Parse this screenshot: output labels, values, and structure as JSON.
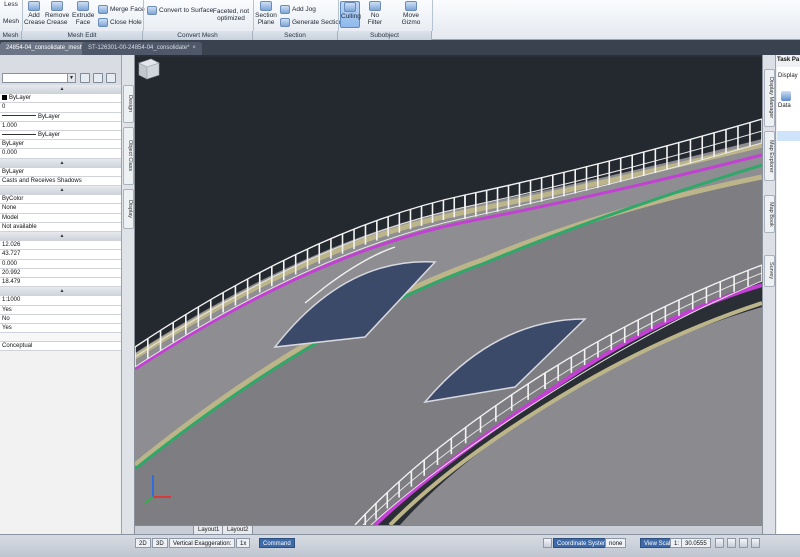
{
  "ribbon": {
    "buttons": {
      "less": "Less",
      "mesh": "Mesh",
      "add_crease": "Add Crease",
      "remove_crease": "Remove Crease",
      "extrude_face": "Extrude Face",
      "merge_face": "Merge Face",
      "close_hole": "Close Hole",
      "convert_to_surface": "Convert to Surface",
      "faceted": "Faceted, not optimized",
      "section_plane": "Section Plane",
      "add_jog": "Add Jog",
      "generate_section": "Generate Section",
      "culling": "Culling",
      "no_filter": "No Filter",
      "move_gizmo": "Move Gizmo"
    },
    "panels": {
      "mesh": "Mesh",
      "mesh_edit": "Mesh Edit",
      "convert_mesh": "Convert Mesh",
      "section": "Section",
      "subobject": "Subobject"
    }
  },
  "tabs": [
    {
      "label": "24854-04_consolidate_mesh*",
      "active": true
    },
    {
      "label": "ST-126301-00-24854-04_consolidate*",
      "active": false
    }
  ],
  "properties": {
    "rows": [
      {
        "type": "cat",
        "text": "▲"
      },
      {
        "type": "swatch",
        "text": "ByLayer"
      },
      {
        "type": "val",
        "text": "0"
      },
      {
        "type": "line",
        "text": "ByLayer"
      },
      {
        "type": "val",
        "text": "1.000"
      },
      {
        "type": "line",
        "text": "ByLayer"
      },
      {
        "type": "val",
        "text": "ByLayer"
      },
      {
        "type": "val",
        "text": "0.000"
      },
      {
        "type": "cat",
        "text": "▲"
      },
      {
        "type": "val",
        "text": "ByLayer"
      },
      {
        "type": "val",
        "text": "Casts and Receives Shadows"
      },
      {
        "type": "cat",
        "text": "▲"
      },
      {
        "type": "val",
        "text": "ByColor"
      },
      {
        "type": "val",
        "text": "None"
      },
      {
        "type": "val",
        "text": "Model"
      },
      {
        "type": "val",
        "text": "Not available"
      },
      {
        "type": "cat",
        "text": "▲"
      },
      {
        "type": "val",
        "text": "12.026"
      },
      {
        "type": "val",
        "text": "43.727"
      },
      {
        "type": "val",
        "text": "0.000"
      },
      {
        "type": "val",
        "text": "20.992"
      },
      {
        "type": "val",
        "text": "18.479"
      },
      {
        "type": "cat",
        "text": "▲"
      },
      {
        "type": "val",
        "text": "1:1000"
      },
      {
        "type": "val",
        "text": "Yes"
      },
      {
        "type": "val",
        "text": "No"
      },
      {
        "type": "val",
        "text": "Yes"
      },
      {
        "type": "gap",
        "text": ""
      },
      {
        "type": "val",
        "text": "Conceptual"
      }
    ],
    "side_tabs": [
      "Design",
      "Object Class",
      "Display"
    ]
  },
  "viewport": {
    "viewcube_label": "TOP",
    "layout_tabs": [
      "Layout1",
      "Layout2"
    ]
  },
  "statusbar": {
    "mode_2d": "2D",
    "mode_3d": "3D",
    "vertical_exaggeration": "Vertical Exaggeration:",
    "exaggeration_value": "1x",
    "command": "Command",
    "coordinate_system": "Coordinate System",
    "coordinate_value": "none",
    "view_scale": "View Scale",
    "view_scale_value": "1:",
    "scale_number": "30.0555"
  },
  "taskpane": {
    "title": "Task Pa",
    "display": "Display",
    "data": "Data",
    "side_tabs": [
      "Display Manager",
      "Map Explorer",
      "Map Book",
      "Survey"
    ]
  },
  "colors": {
    "rail": "#f2f2f2",
    "deck": "#8e8e92",
    "purple_edge": "#c43fd3",
    "green_edge": "#2fa86a",
    "tan_curb": "#bdb58a",
    "viewport_bg": "#24282f"
  }
}
